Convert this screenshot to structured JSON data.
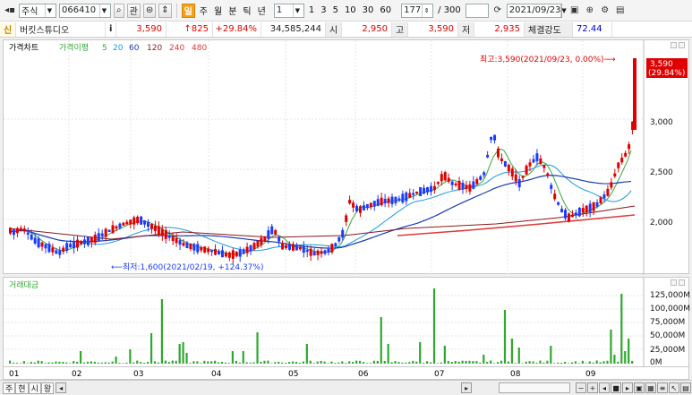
{
  "toolbar": {
    "market": "주식",
    "code": "066410",
    "btn_chart": "관",
    "period_buttons": [
      "일",
      "주",
      "월",
      "분",
      "틱",
      "년"
    ],
    "interval_value": "1",
    "quick_intervals": [
      "1",
      "3",
      "5",
      "10",
      "30",
      "60"
    ],
    "count_value": "177",
    "count_total": "/ 300",
    "date_value": "2021/09/23"
  },
  "quote": {
    "name": "버킷스튜디오",
    "info_icon": "i",
    "price": "3,590",
    "change": "↑825",
    "change_pct": "+29.84%",
    "volume": "34,585,244",
    "open_label": "시",
    "open": "2,950",
    "high_label": "고",
    "high": "3,590",
    "low_label": "저",
    "low": "2,935",
    "strength_label": "체결강도",
    "strength": "72.44"
  },
  "main_chart": {
    "legend": [
      "가격차트",
      "가격이평",
      "5",
      "20",
      "60",
      "120",
      "240",
      "480"
    ],
    "high_note": "최고:3,590(2021/09/23, 0.00%)⟶",
    "low_note": "⟵최저:1,600(2021/02/19, +124.37%)",
    "last_price_box": "3,590",
    "last_price_pct": "(29.84%)",
    "y_ticks": [
      "3,000",
      "2,500",
      "2,000"
    ]
  },
  "volume_chart": {
    "legend": "거래대금",
    "y_ticks": [
      "125,000M",
      "100,000M",
      "75,000M",
      "50,000M",
      "25,000M",
      "0M"
    ]
  },
  "x_axis": [
    "01",
    "02",
    "03",
    "04",
    "05",
    "06",
    "07",
    "08",
    "09"
  ],
  "bottom_tabs": [
    "주",
    "현",
    "시",
    "왕"
  ],
  "colors": {
    "up": "#e00000",
    "down": "#1a3cff",
    "ma5": "#3aa53a",
    "ma20": "#1a9adf",
    "ma60": "#1a3cb0",
    "ma120": "#8b1a1a",
    "ma240": "#e03a3a",
    "vol": "#2ea82e"
  }
}
